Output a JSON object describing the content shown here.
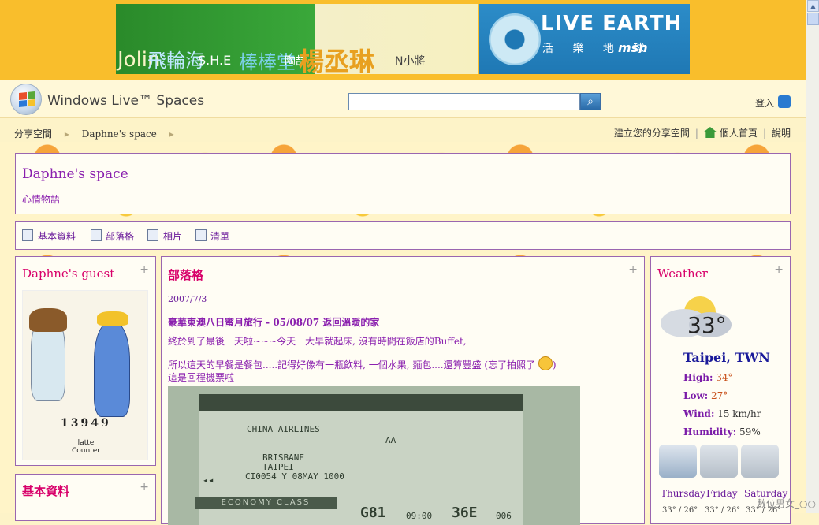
{
  "ads": {
    "left_words": [
      "Jolin",
      "飛輪海",
      "S.H.E",
      "棒棒堂",
      "陶喆",
      "楊丞琳",
      "N小將"
    ],
    "live_earth": {
      "title": "LIVE EARTH",
      "subtitle": "活 樂 地 球",
      "brand": "msn"
    }
  },
  "header": {
    "brand": "Windows Live™ Spaces",
    "search_placeholder": "",
    "search_icon": "search-icon",
    "signin_label": "登入"
  },
  "breadcrumb": [
    "分享空間",
    "Daphne's space"
  ],
  "top_links": [
    "建立您的分享空間",
    "個人首頁",
    "說明"
  ],
  "space": {
    "title": "Daphne's space",
    "subtitle": "心情物語"
  },
  "nav": [
    "基本資料",
    "部落格",
    "相片",
    "清單"
  ],
  "guest": {
    "title": "Daphne's guest",
    "count": "13949",
    "counter_brand": "latte",
    "counter_label": "Counter"
  },
  "info": {
    "title": "基本資料"
  },
  "blog": {
    "heading": "部落格",
    "date": "2007/7/3",
    "post_title": "豪華東澳八日蜜月旅行 - 05/08/07 返回溫暖的家",
    "line1": "終於到了最後一天啦~~~今天一大早就起床, 沒有時間在飯店的Buffet,",
    "line2": "所以這天的早餐是餐包.....記得好像有一瓶飲料, 一個水果, 麵包....還算豐盛 (忘了拍照了",
    "line2_end": ")",
    "line3": "這是回程機票啦",
    "ticket": {
      "airline": "CHINA AIRLINES",
      "aa": "AA",
      "from": "BRISBANE",
      "to": "TAIPEI",
      "flight": "CI0054 Y 08MAY 1000",
      "class": "ECONOMY CLASS",
      "gate": "G81",
      "time": "09:00",
      "seat": "36E",
      "seq": "006"
    }
  },
  "weather": {
    "title": "Weather",
    "temp": "33°",
    "city": "Taipei, TWN",
    "high_label": "High:",
    "high": "34°",
    "low_label": "Low:",
    "low": "27°",
    "wind_label": "Wind:",
    "wind": "15 km/hr",
    "humidity_label": "Humidity:",
    "humidity": "59%",
    "forecast": [
      {
        "day": "Thursday",
        "temp": "33° / 26°"
      },
      {
        "day": "Friday",
        "temp": "33° / 26°"
      },
      {
        "day": "Saturday",
        "temp": "33° / 26°"
      }
    ]
  },
  "watermark": "數位男女_○○",
  "colors": {
    "accent_purple": "#8a1fae",
    "heading_pink": "#d8006a",
    "top_band": "#f9be2c"
  }
}
